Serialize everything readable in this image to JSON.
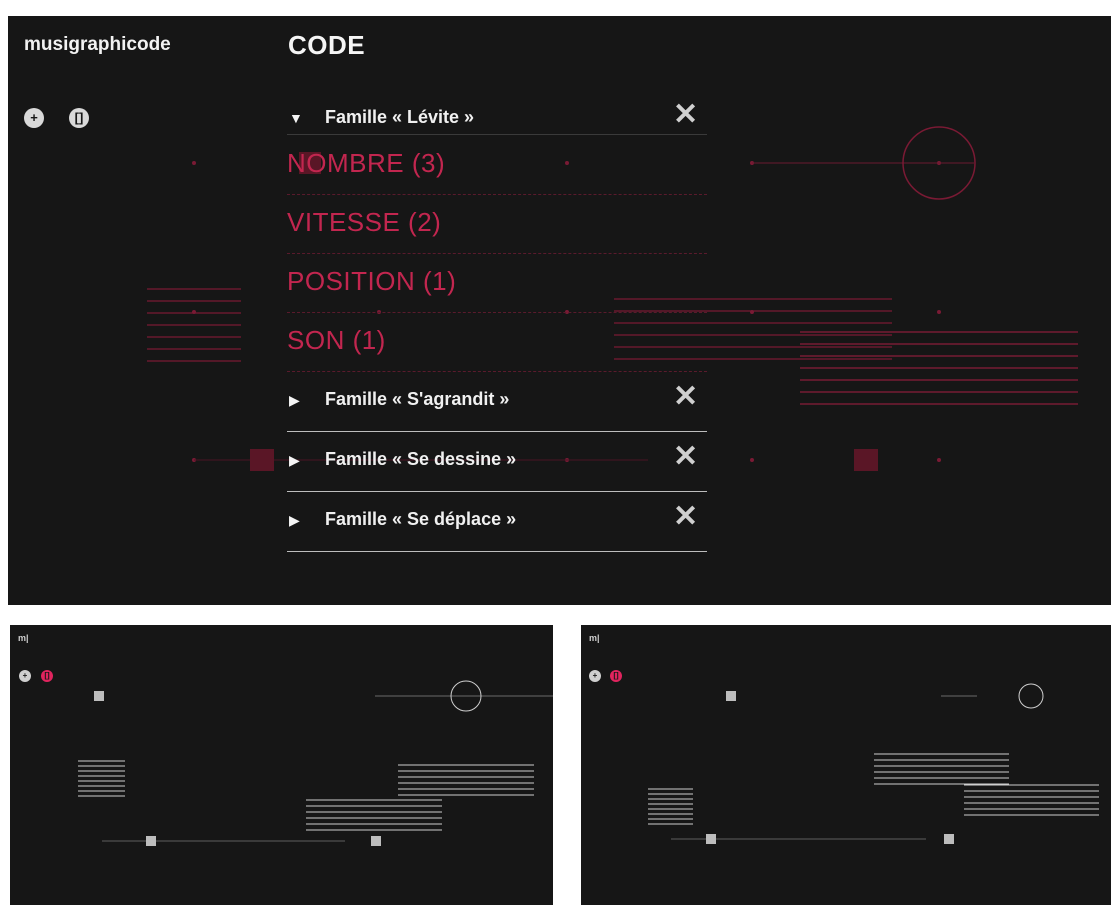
{
  "app": {
    "logo": "musigraphicode",
    "mini_logo": "m|"
  },
  "toolbar": {
    "add_label": "+",
    "brackets_label": "[]"
  },
  "panel": {
    "title": "CODE",
    "families": [
      {
        "label": "Famille « Lévite »",
        "expanded": true,
        "close": "✕",
        "toggle": "▼"
      },
      {
        "label": "Famille « S'agrandit »",
        "expanded": false,
        "close": "✕",
        "toggle": "▶"
      },
      {
        "label": "Famille « Se dessine »",
        "expanded": false,
        "close": "✕",
        "toggle": "▶"
      },
      {
        "label": "Famille « Se déplace »",
        "expanded": false,
        "close": "✕",
        "toggle": "▶"
      }
    ],
    "properties": [
      {
        "label": "NOMBRE (3)"
      },
      {
        "label": "VITESSE (2)"
      },
      {
        "label": "POSITION (1)"
      },
      {
        "label": "SON (1)"
      }
    ]
  },
  "colors": {
    "background": "#161616",
    "accent": "#c2264f",
    "accent_dim": "#6a1a30",
    "text": "#f0f0f0",
    "mini_shapes": "#c8c8c8",
    "mini_active_tool": "#e0245e"
  },
  "icons": [
    "add-icon",
    "brackets-icon",
    "triangle-down-icon",
    "triangle-right-icon",
    "close-icon"
  ]
}
